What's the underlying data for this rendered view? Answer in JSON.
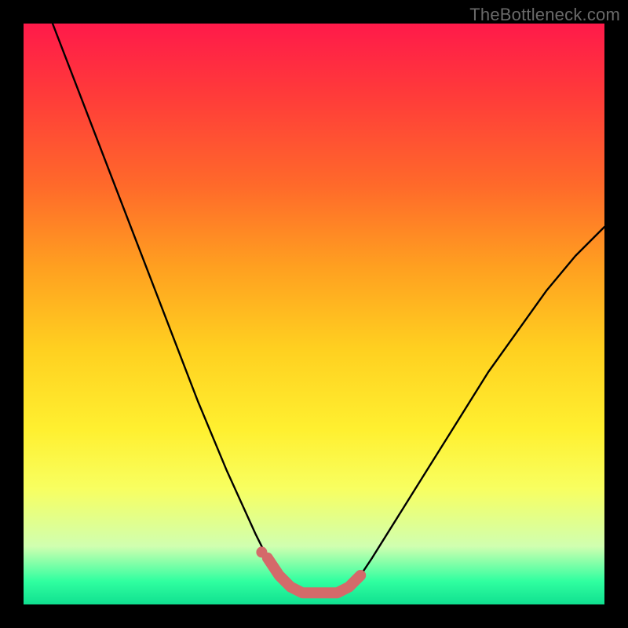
{
  "watermark": "TheBottleneck.com",
  "chart_data": {
    "type": "line",
    "title": "",
    "xlabel": "",
    "ylabel": "",
    "xlim": [
      0,
      100
    ],
    "ylim": [
      0,
      100
    ],
    "grid": false,
    "series": [
      {
        "name": "bottleneck-curve",
        "x": [
          5,
          10,
          15,
          20,
          25,
          30,
          35,
          40,
          42,
          44,
          46,
          48,
          50,
          52,
          54,
          56,
          58,
          60,
          65,
          70,
          75,
          80,
          85,
          90,
          95,
          100
        ],
        "values": [
          100,
          87,
          74,
          61,
          48,
          35,
          23,
          12,
          8,
          5,
          3,
          2,
          2,
          2,
          2,
          3,
          5,
          8,
          16,
          24,
          32,
          40,
          47,
          54,
          60,
          65
        ]
      }
    ],
    "markers": [
      {
        "name": "optimal-range",
        "x": [
          42,
          44,
          46,
          48,
          50,
          52,
          54,
          56,
          58
        ],
        "values": [
          8,
          5,
          3,
          2,
          2,
          2,
          2,
          3,
          5
        ],
        "color": "#d96a6a"
      }
    ],
    "background": "red-yellow-green vertical gradient"
  }
}
